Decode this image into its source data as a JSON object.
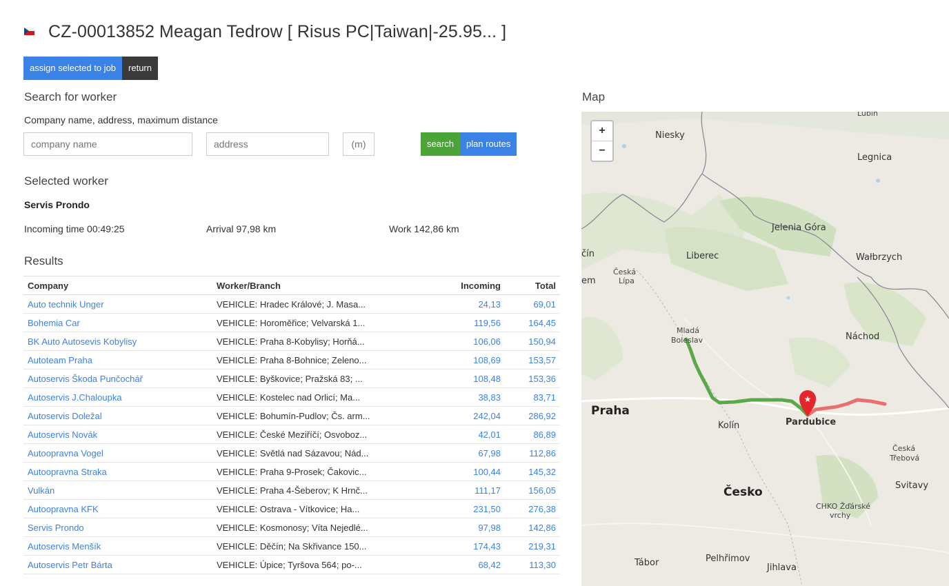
{
  "header": {
    "title": "CZ-00013852 Meagan Tedrow [ Risus PC|Taiwan|-25.95... ]"
  },
  "toolbar": {
    "assign_label": "assign selected to job",
    "return_label": "return"
  },
  "search": {
    "heading": "Search for worker",
    "hint": "Company name, address, maximum distance",
    "company_placeholder": "company name",
    "address_placeholder": "address",
    "distance_placeholder": "(m)",
    "search_label": "search",
    "plan_label": "plan routes"
  },
  "selected": {
    "heading": "Selected worker",
    "name": "Servis Prondo",
    "incoming": "Incoming time 00:49:25",
    "arrival": "Arrival 97,98 km",
    "work": "Work 142,86 km"
  },
  "results": {
    "heading": "Results",
    "columns": {
      "company": "Company",
      "worker": "Worker/Branch",
      "incoming": "Incoming",
      "total": "Total"
    },
    "rows": [
      {
        "company": "Auto technik Unger",
        "worker": "VEHICLE: Hradec Králové; J. Masa...",
        "incoming": "24,13",
        "total": "69,01"
      },
      {
        "company": "Bohemia Car",
        "worker": "VEHICLE: Horoměřice; Velvarská 1...",
        "incoming": "119,56",
        "total": "164,45"
      },
      {
        "company": "BK Auto Autosevis Kobylisy",
        "worker": "VEHICLE: Praha 8-Kobylisy; Horňá...",
        "incoming": "106,06",
        "total": "150,94"
      },
      {
        "company": "Autoteam Praha",
        "worker": "VEHICLE: Praha 8-Bohnice; Zeleno...",
        "incoming": "108,69",
        "total": "153,57"
      },
      {
        "company": "Autoservis Škoda Punčochář",
        "worker": "VEHICLE: Byškovice; Pražská 83; ...",
        "incoming": "108,48",
        "total": "153,36"
      },
      {
        "company": "Autoservis J.Chaloupka",
        "worker": "VEHICLE: Kostelec nad Orlicí; Ma...",
        "incoming": "38,83",
        "total": "83,71"
      },
      {
        "company": "Autoservis Doležal",
        "worker": "VEHICLE: Bohumín-Pudlov; Čs. arm...",
        "incoming": "242,04",
        "total": "286,92"
      },
      {
        "company": "Autoservis Novák",
        "worker": "VEHICLE: České Meziříčí; Osvoboz...",
        "incoming": "42,01",
        "total": "86,89"
      },
      {
        "company": "Autoopravna Vogel",
        "worker": "VEHICLE: Světlá nad Sázavou; Nád...",
        "incoming": "67,98",
        "total": "112,86"
      },
      {
        "company": "Autoopravna Straka",
        "worker": "VEHICLE: Praha 9-Prosek; Čakovic...",
        "incoming": "100,44",
        "total": "145,32"
      },
      {
        "company": "Vulkán",
        "worker": "VEHICLE: Praha 4-Šeberov; K Hrnč...",
        "incoming": "111,17",
        "total": "156,05"
      },
      {
        "company": "Autoopravna KFK",
        "worker": "VEHICLE: Ostrava - Vítkovice; Ha...",
        "incoming": "231,50",
        "total": "276,38"
      },
      {
        "company": "Servis Prondo",
        "worker": "VEHICLE: Kosmonosy; Víta Nejedlé...",
        "incoming": "97,98",
        "total": "142,86"
      },
      {
        "company": "Autoservis Menšík",
        "worker": "VEHICLE: Děčín; Na Skřivance 150...",
        "incoming": "174,43",
        "total": "219,31"
      },
      {
        "company": "Autoservis Petr Bárta",
        "worker": "VEHICLE: Úpice; Tyršova 564; po-...",
        "incoming": "68,42",
        "total": "113,30"
      }
    ]
  },
  "map": {
    "heading": "Map",
    "zoom_in": "+",
    "zoom_out": "−",
    "route_color_1": "#5aa84a",
    "route_color_2": "#e8595a",
    "marker_color": "#e3262b",
    "places": {
      "niesky": "Niesky",
      "legnica": "Legnica",
      "zabin": "Lubin",
      "jelenia": "Jelenia Góra",
      "liberec": "Liberec",
      "walbrzych": "Wałbrzych",
      "decin": "čín",
      "ceska_lipa_1": "Česká",
      "ceska_lipa_2": "Lípa",
      "em": "em",
      "mlada_1": "Mladá",
      "mlada_2": "Boleslav",
      "nachod": "Náchod",
      "praha": "Praha",
      "kolin": "Kolín",
      "pardubice": "Pardubice",
      "ceska_trebova_1": "Česká",
      "ceska_trebova_2": "Třebová",
      "cesko": "Česko",
      "svitavy": "Svitavy",
      "chko_1": "CHKO Žďárské",
      "chko_2": "vrchy",
      "tabor": "Tábor",
      "pelhrimov": "Pelhřimov",
      "jihlava": "Jihlava"
    }
  }
}
